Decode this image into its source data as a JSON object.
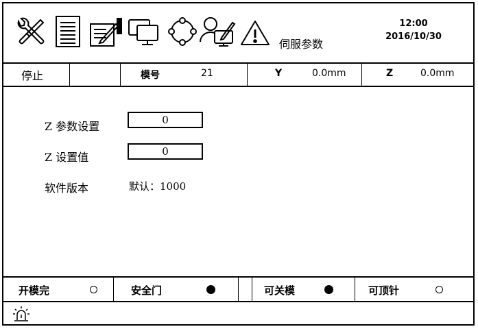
{
  "header": {
    "page_name": "伺服参数",
    "time": "12:00",
    "date": "2016/10/30",
    "icons": [
      "tools-icon",
      "document-icon",
      "edit-notes-icon",
      "monitors-icon",
      "cycle-icon",
      "operator-icon",
      "warning-icon"
    ]
  },
  "status": {
    "state": "停止",
    "mold_label": "模号",
    "mold_value": "21",
    "y_label": "Y",
    "y_value": "0.0mm",
    "z_label": "Z",
    "z_value": "0.0mm"
  },
  "params": {
    "z_param_label": "Z 参数设置",
    "z_param_value": "0",
    "z_set_label": "Z 设置值",
    "z_set_value": "0",
    "version_label": "软件版本",
    "version_value": "默认：1000"
  },
  "indicators": [
    {
      "label": "开模完",
      "state": "off"
    },
    {
      "label": "安全门",
      "state": "on"
    },
    {
      "label": "可关模",
      "state": "on"
    },
    {
      "label": "可顶针",
      "state": "off"
    }
  ],
  "footer": {
    "icon": "alarm-lamp-icon"
  }
}
